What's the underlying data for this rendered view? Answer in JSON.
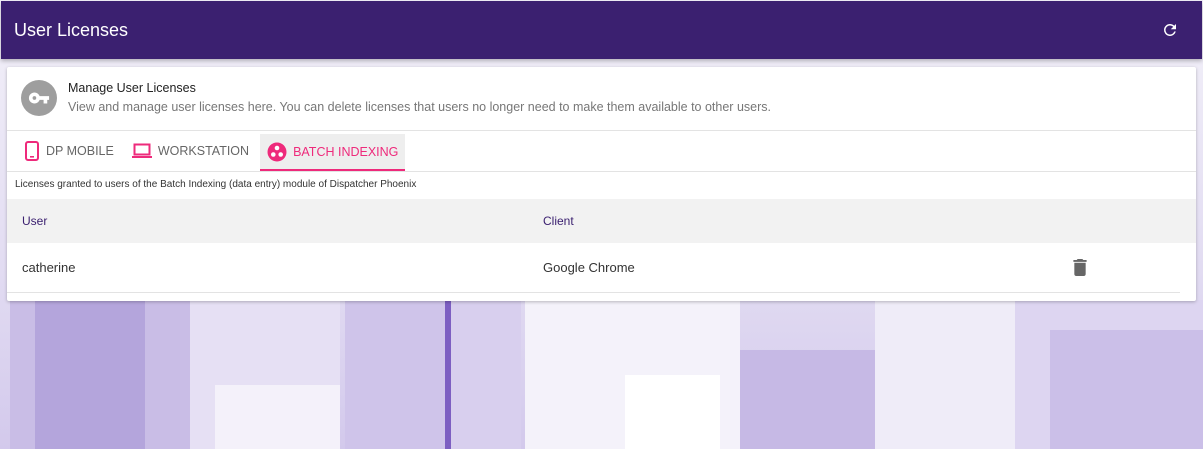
{
  "appbar": {
    "title": "User Licenses",
    "refresh_icon": "refresh-icon"
  },
  "header": {
    "icon": "key-icon",
    "title": "Manage User Licenses",
    "subtitle": "View and manage user licenses here. You can delete licenses that users no longer need to make them available to other users."
  },
  "tabs": [
    {
      "label": "DP MOBILE",
      "icon": "mobile-phone-icon",
      "active": false
    },
    {
      "label": "WORKSTATION",
      "icon": "laptop-icon",
      "active": false
    },
    {
      "label": "BATCH INDEXING",
      "icon": "batch-indexing-icon",
      "active": true
    }
  ],
  "description": "Licenses granted to users of the Batch Indexing (data entry) module of Dispatcher Phoenix",
  "table": {
    "columns": [
      "User",
      "Client"
    ],
    "rows": [
      {
        "user": "catherine",
        "client": "Google Chrome",
        "action_icon": "trash-icon"
      }
    ]
  },
  "colors": {
    "appbar": "#3b2070",
    "accent": "#ee2a7b",
    "header_text": "#3b2070"
  }
}
